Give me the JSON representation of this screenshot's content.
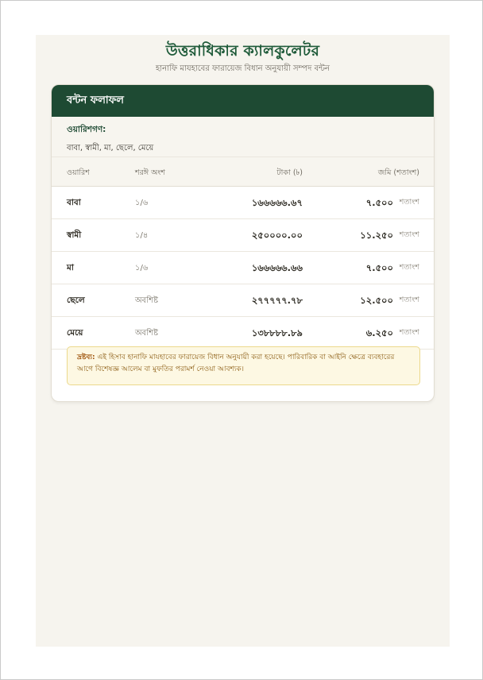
{
  "header": {
    "title": "উত্তরাধিকার ক্যালকুলেটর",
    "subtitle": "হানাফি মাযহাবের ফারায়েজ বিধান অনুযায়ী সম্পদ বন্টন"
  },
  "card": {
    "title": "বন্টন ফলাফল",
    "heirs_label": "ওয়ারিশগণ:",
    "heirs_list": "বাবা, স্বামী, মা, ছেলে, মেয়ে"
  },
  "table": {
    "columns": {
      "heir": "ওয়ারিশ",
      "share": "শরঈ অংশ",
      "money": "টাকা (৳)",
      "land": "জমি (শতাংশ)"
    },
    "unit": "শতাংশ",
    "rows": [
      {
        "heir": "বাবা",
        "share": "১/৬",
        "money": "১৬৬৬৬৬.৬৭",
        "land": "৭.৫০০"
      },
      {
        "heir": "স্বামী",
        "share": "১/৪",
        "money": "২৫০০০০.০০",
        "land": "১১.২৫০"
      },
      {
        "heir": "মা",
        "share": "১/৬",
        "money": "১৬৬৬৬৬.৬৬",
        "land": "৭.৫০০"
      },
      {
        "heir": "ছেলে",
        "share": "অবশিষ্ট",
        "money": "২৭৭৭৭৭.৭৮",
        "land": "১২.৫০০"
      },
      {
        "heir": "মেয়ে",
        "share": "অবশিষ্ট",
        "money": "১৩৮৮৮৮.৮৯",
        "land": "৬.২৫০"
      }
    ]
  },
  "note": {
    "label": "দ্রষ্টব্য:",
    "text": "এই হিসাব হানাফি মাযহাবের ফারায়েজ বিধান অনুযায়ী করা হয়েছে। পারিবারিক বা আইনি ক্ষেত্রে ব্যবহারের আগে বিশেষজ্ঞ আলেম বা মুফতির পরামর্শ নেওয়া আবশ্যক।"
  },
  "colors": {
    "brand_green": "#1e4a33",
    "title_green": "#1e5a39",
    "page_bg": "#f6f4ee",
    "note_bg": "#fdf8e3",
    "note_border": "#ecd98c"
  }
}
